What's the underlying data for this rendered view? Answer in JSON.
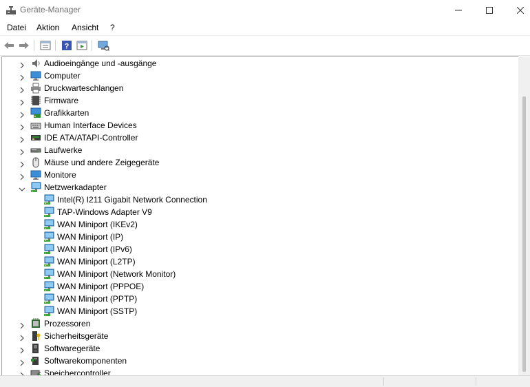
{
  "window": {
    "title": "Geräte-Manager"
  },
  "menu": [
    {
      "label": "Datei",
      "name": "menu-datei"
    },
    {
      "label": "Aktion",
      "name": "menu-aktion"
    },
    {
      "label": "Ansicht",
      "name": "menu-ansicht"
    },
    {
      "label": "?",
      "name": "menu-help"
    }
  ],
  "toolbar": [
    {
      "icon": "back-arrow-icon"
    },
    {
      "icon": "forward-arrow-icon"
    },
    {
      "icon": "properties-icon"
    },
    {
      "icon": "help-icon"
    },
    {
      "icon": "driver-update-icon"
    },
    {
      "icon": "scan-hardware-icon"
    }
  ],
  "tree": [
    {
      "label": "Audioeingänge und -ausgänge",
      "icon": "speaker-icon",
      "level": 0,
      "state": "collapsed"
    },
    {
      "label": "Computer",
      "icon": "monitor-icon",
      "level": 0,
      "state": "collapsed"
    },
    {
      "label": "Druckwarteschlangen",
      "icon": "printer-icon",
      "level": 0,
      "state": "collapsed"
    },
    {
      "label": "Firmware",
      "icon": "chip-icon",
      "level": 0,
      "state": "collapsed"
    },
    {
      "label": "Grafikkarten",
      "icon": "display-adapter-icon",
      "level": 0,
      "state": "collapsed"
    },
    {
      "label": "Human Interface Devices",
      "icon": "keyboard-icon",
      "level": 0,
      "state": "collapsed"
    },
    {
      "label": "IDE ATA/ATAPI-Controller",
      "icon": "ide-controller-icon",
      "level": 0,
      "state": "collapsed"
    },
    {
      "label": "Laufwerke",
      "icon": "drive-icon",
      "level": 0,
      "state": "collapsed"
    },
    {
      "label": "Mäuse und andere Zeigegeräte",
      "icon": "mouse-icon",
      "level": 0,
      "state": "collapsed"
    },
    {
      "label": "Monitore",
      "icon": "monitor-icon",
      "level": 0,
      "state": "collapsed"
    },
    {
      "label": "Netzwerkadapter",
      "icon": "network-adapter-icon",
      "level": 0,
      "state": "expanded"
    },
    {
      "label": "Intel(R) I211 Gigabit Network Connection",
      "icon": "network-adapter-icon",
      "level": 1
    },
    {
      "label": "TAP-Windows Adapter V9",
      "icon": "network-adapter-icon",
      "level": 1
    },
    {
      "label": "WAN Miniport (IKEv2)",
      "icon": "network-adapter-icon",
      "level": 1
    },
    {
      "label": "WAN Miniport (IP)",
      "icon": "network-adapter-icon",
      "level": 1
    },
    {
      "label": "WAN Miniport (IPv6)",
      "icon": "network-adapter-icon",
      "level": 1
    },
    {
      "label": "WAN Miniport (L2TP)",
      "icon": "network-adapter-icon",
      "level": 1
    },
    {
      "label": "WAN Miniport (Network Monitor)",
      "icon": "network-adapter-icon",
      "level": 1
    },
    {
      "label": "WAN Miniport (PPPOE)",
      "icon": "network-adapter-icon",
      "level": 1
    },
    {
      "label": "WAN Miniport (PPTP)",
      "icon": "network-adapter-icon",
      "level": 1
    },
    {
      "label": "WAN Miniport (SSTP)",
      "icon": "network-adapter-icon",
      "level": 1
    },
    {
      "label": "Prozessoren",
      "icon": "processor-icon",
      "level": 0,
      "state": "collapsed"
    },
    {
      "label": "Sicherheitsgeräte",
      "icon": "security-key-icon",
      "level": 0,
      "state": "collapsed"
    },
    {
      "label": "Softwaregeräte",
      "icon": "software-device-icon",
      "level": 0,
      "state": "collapsed"
    },
    {
      "label": "Softwarekomponenten",
      "icon": "software-component-icon",
      "level": 0,
      "state": "collapsed"
    },
    {
      "label": "Speichercontroller",
      "icon": "storage-controller-icon",
      "level": 0,
      "state": "collapsed"
    }
  ]
}
